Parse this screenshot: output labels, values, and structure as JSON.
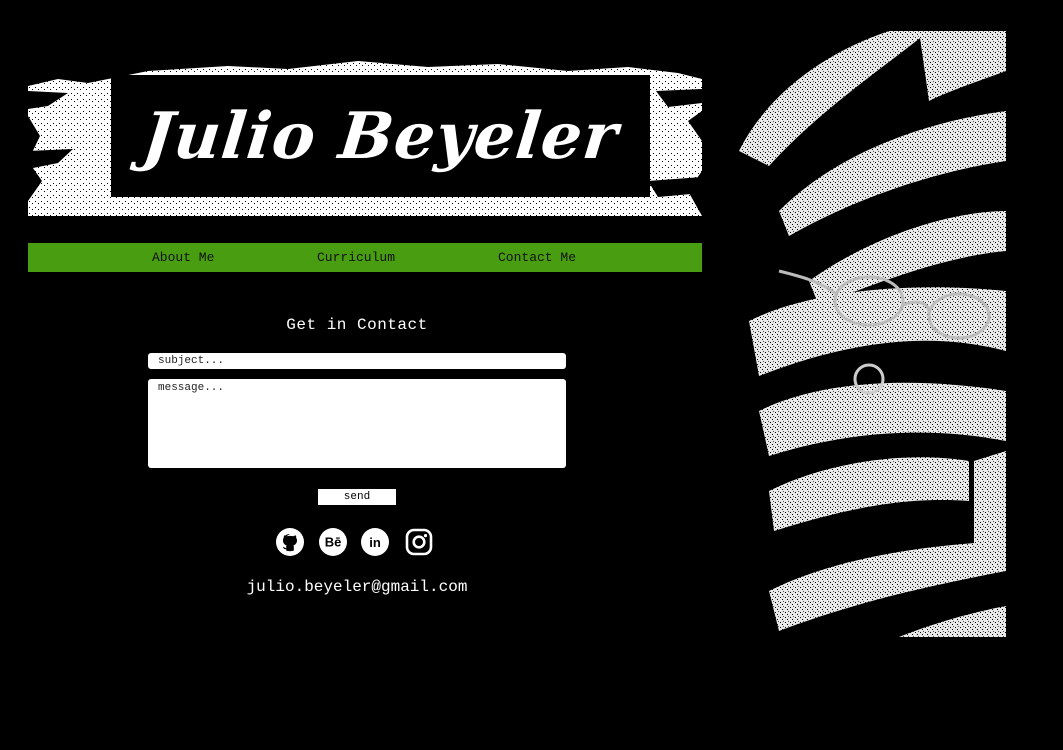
{
  "header": {
    "title": "Julio Beyeler"
  },
  "nav": {
    "items": [
      {
        "label": "About Me"
      },
      {
        "label": "Curriculum"
      },
      {
        "label": "Contact Me"
      }
    ]
  },
  "contact": {
    "title": "Get in Contact",
    "subject_placeholder": "subject...",
    "message_placeholder": "message...",
    "send_label": "send",
    "email": "julio.beyeler@gmail.com"
  },
  "socials": [
    {
      "icon": "github-icon"
    },
    {
      "icon": "behance-icon"
    },
    {
      "icon": "linkedin-icon"
    },
    {
      "icon": "instagram-icon"
    }
  ],
  "colors": {
    "background": "#000000",
    "nav": "#489e10",
    "text": "#ffffff"
  }
}
